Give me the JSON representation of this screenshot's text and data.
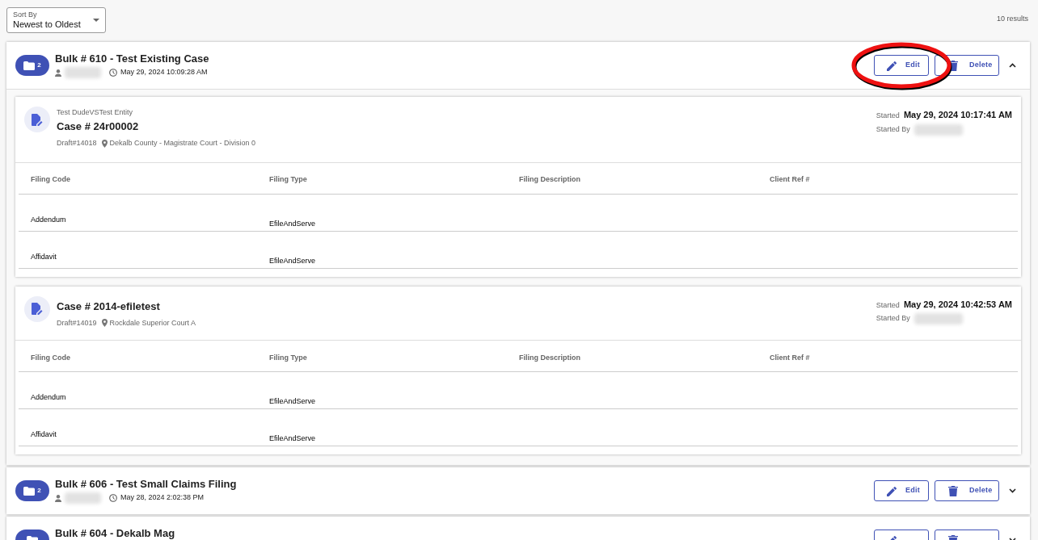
{
  "sort": {
    "label": "Sort By",
    "value": "Newest to Oldest"
  },
  "results": "10 results",
  "bulks": [
    {
      "badge_count": "2",
      "title": "Bulk # 610 - Test Existing Case",
      "user_hidden": true,
      "date": "May 29, 2024 10:09:28 AM",
      "expanded": true,
      "annotated": true,
      "edit": "Edit",
      "delete": "Delete",
      "cases": [
        {
          "party": "Test DudeVSTest Entity",
          "title": "Case # 24r00002",
          "draft": "Draft#14018",
          "court": "Dekalb County - Magistrate Court - Division 0",
          "started_label": "Started",
          "started": "May 29, 2024 10:17:41 AM",
          "started_by_label": "Started By",
          "columns": [
            "Filing Code",
            "Filing Type",
            "Filing Description",
            "Client Ref #"
          ],
          "rows": [
            {
              "filing_code": "Addendum",
              "filing_type": "EfileAndServe"
            },
            {
              "filing_code": "Affidavit",
              "filing_type": "EfileAndServe"
            }
          ]
        },
        {
          "title": "Case # 2014-efiletest",
          "draft": "Draft#14019",
          "court": "Rockdale Superior Court A",
          "started_label": "Started",
          "started": "May 29, 2024 10:42:53 AM",
          "started_by_label": "Started By",
          "columns": [
            "Filing Code",
            "Filing Type",
            "Filing Description",
            "Client Ref #"
          ],
          "rows": [
            {
              "filing_code": "Addendum",
              "filing_type": "EfileAndServe"
            },
            {
              "filing_code": "Affidavit",
              "filing_type": "EfileAndServe"
            }
          ]
        }
      ]
    },
    {
      "badge_count": "2",
      "title": "Bulk # 606 - Test Small Claims Filing",
      "user_hidden": true,
      "date": "May 28, 2024 2:02:38 PM",
      "expanded": false,
      "annotated": false,
      "edit": "Edit",
      "delete": "Delete"
    },
    {
      "title": "Bulk # 604 - Dekalb Mag",
      "expanded": false,
      "annotated": false
    }
  ]
}
